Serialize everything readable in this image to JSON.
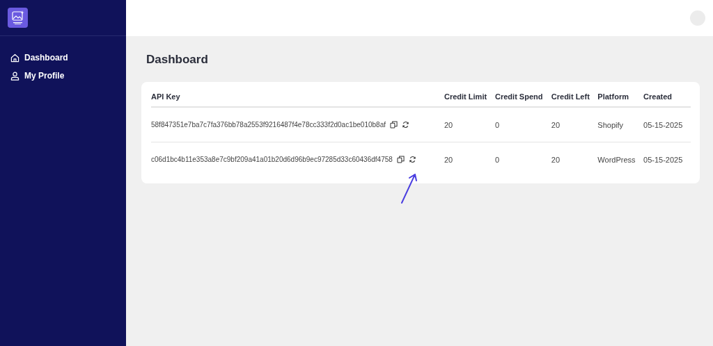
{
  "sidebar": {
    "items": [
      {
        "label": "Dashboard",
        "kind": "home"
      },
      {
        "label": "My Profile",
        "kind": "user"
      }
    ]
  },
  "page": {
    "title": "Dashboard"
  },
  "table": {
    "columns": [
      "API Key",
      "Credit Limit",
      "Credit Spend",
      "Credit Left",
      "Platform",
      "Created"
    ],
    "rows": [
      {
        "api_key": "58f847351e7ba7c7fa376bb78a2553f9216487f4e78cc333f2d0ac1be010b8af",
        "credit_limit": "20",
        "credit_spend": "0",
        "credit_left": "20",
        "platform": "Shopify",
        "created": "05-15-2025"
      },
      {
        "api_key": "c06d1bc4b11e353a8e7c9bf209a41a01b20d6d96b9ec97285d33c60436df4758",
        "credit_limit": "20",
        "credit_spend": "0",
        "credit_left": "20",
        "platform": "WordPress",
        "created": "05-15-2025"
      }
    ]
  }
}
